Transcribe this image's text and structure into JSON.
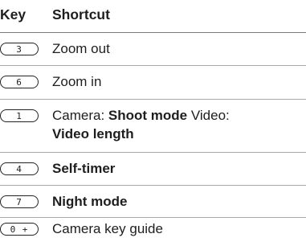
{
  "header": {
    "key_label": "Key",
    "shortcut_label": "Shortcut"
  },
  "rows": [
    {
      "key": "3",
      "text": "Zoom out"
    },
    {
      "key": "6",
      "text": "Zoom in"
    },
    {
      "key": "1",
      "text_parts": [
        "Camera: ",
        "Shoot mode",
        " Video:",
        "Video length"
      ]
    },
    {
      "key": "4",
      "text": "Self-timer",
      "bold": true
    },
    {
      "key": "7",
      "text": "Night mode",
      "bold": true
    },
    {
      "key": "0 +",
      "text": "Camera key guide"
    }
  ]
}
